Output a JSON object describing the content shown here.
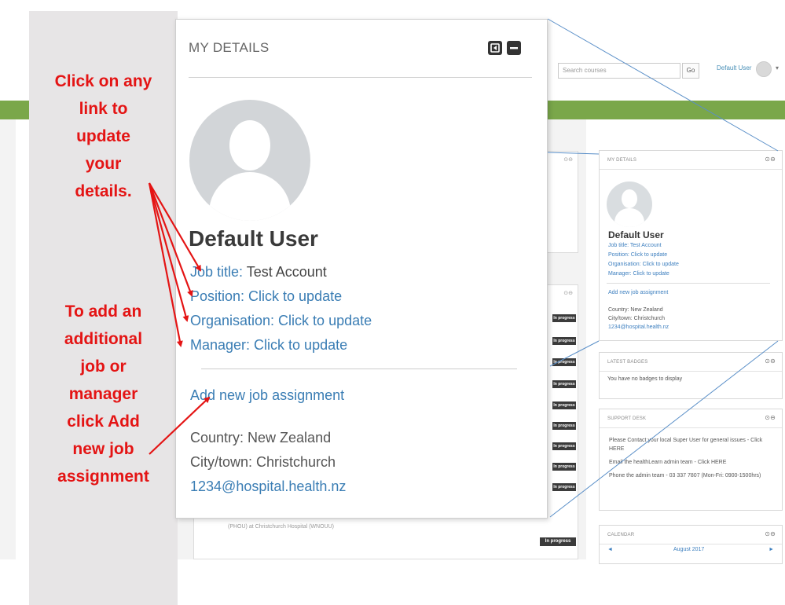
{
  "header": {
    "search_placeholder": "Search courses",
    "go_label": "Go",
    "user_name": "Default User"
  },
  "background": {
    "progress_badge": "In progress",
    "hospital_text": "(PHOU) at Christchurch Hospital (WNOUU)"
  },
  "side_blocks": {
    "my_details": {
      "title": "MY DETAILS",
      "name": "Default User",
      "job_title": "Job title: Test Account",
      "position": "Position: Click to update",
      "organisation": "Organisation: Click to update",
      "manager": "Manager: Click to update",
      "add_job": "Add new job assignment",
      "country": "Country: New Zealand",
      "city": "City/town: Christchurch",
      "email": "1234@hospital.health.nz"
    },
    "latest_badges": {
      "title": "LATEST BADGES",
      "text": "You have no badges to display"
    },
    "support_desk": {
      "title": "SUPPORT DESK",
      "line1": "Please Contact your local Super User for general issues - Click HERE",
      "line2": "Email the healthLearn admin team - Click HERE",
      "line3": "Phone the admin team - 03 337 7807 (Mon-Fri: 0900-1500hrs)"
    },
    "calendar": {
      "title": "CALENDAR",
      "month": "August 2017",
      "prev": "◄",
      "next": "►"
    }
  },
  "callout": {
    "title": "MY DETAILS",
    "name": "Default User",
    "job_title_label": "Job title:",
    "job_title_value": "Test Account",
    "position_link": "Position: Click to update",
    "organisation_link": "Organisation: Click to update",
    "manager_link": "Manager: Click to update",
    "add_job_link": "Add new job assignment",
    "country": "Country: New Zealand",
    "city": "City/town: Christchurch",
    "email": "1234@hospital.health.nz"
  },
  "instructions": {
    "update": [
      "Click on any",
      "link to",
      "update",
      "your",
      "details."
    ],
    "add": [
      "To add an",
      "additional",
      "job or",
      "manager",
      "click Add",
      "new job",
      "assignment"
    ]
  },
  "colors": {
    "instruction_red": "#e41414",
    "link_blue": "#3a7db4",
    "header_green": "#7aa74a",
    "panel_grey": "#e7e5e6"
  }
}
